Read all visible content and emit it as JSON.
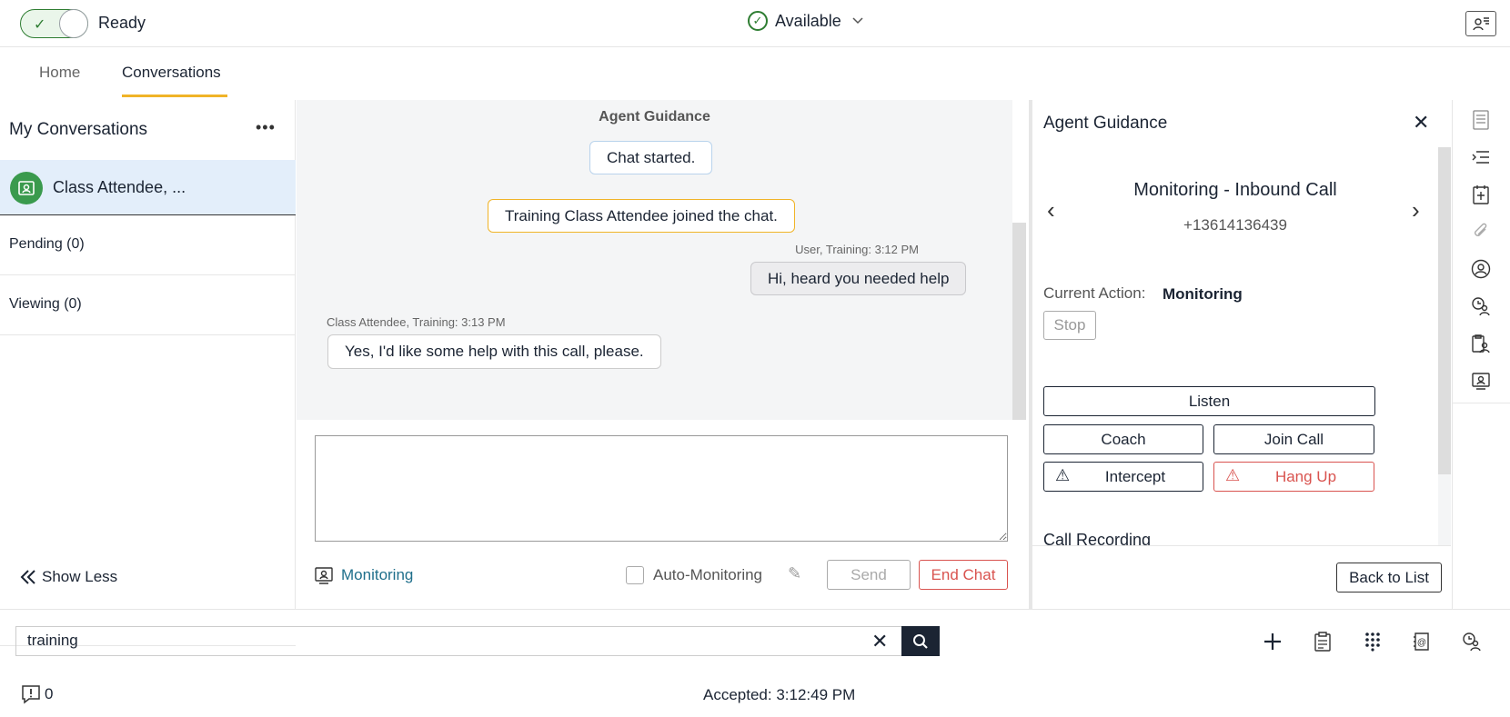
{
  "topbar": {
    "ready_label": "Ready",
    "status_label": "Available"
  },
  "nav": {
    "tabs": [
      {
        "label": "Home"
      },
      {
        "label": "Conversations"
      }
    ]
  },
  "left": {
    "title": "My Conversations",
    "active_conversation": "Class Attendee, ...",
    "pending": "Pending (0)",
    "viewing": "Viewing (0)",
    "show_less": "Show Less"
  },
  "chat": {
    "title": "Agent Guidance",
    "system1": "Chat started.",
    "system2": "Training Class Attendee joined the chat.",
    "msg1_meta": "User, Training: 3:12 PM",
    "msg1_text": "Hi, heard you needed help",
    "msg2_meta": "Class Attendee, Training: 3:13 PM",
    "msg2_text": "Yes, I'd like some help with this call, please.",
    "monitoring_label": "Monitoring",
    "auto_monitoring_label": "Auto-Monitoring",
    "send_label": "Send",
    "end_chat_label": "End Chat"
  },
  "guidance": {
    "title": "Agent Guidance",
    "call_title": "Monitoring - Inbound Call",
    "phone": "+13614136439",
    "current_action_label": "Current Action:",
    "current_action_value": "Monitoring",
    "stop_label": "Stop",
    "listen_label": "Listen",
    "coach_label": "Coach",
    "join_label": "Join Call",
    "intercept_label": "Intercept",
    "hangup_label": "Hang Up",
    "call_recording_label": "Call Recording",
    "back_label": "Back to List"
  },
  "bottom": {
    "search_value": "training",
    "notif_count": "0",
    "accepted": "Accepted: 3:12:49 PM"
  },
  "colors": {
    "accent": "#f0b428",
    "success": "#2e7d32",
    "danger": "#d9534f",
    "selected_row": "#e3eefa",
    "dark": "#1b2433"
  }
}
